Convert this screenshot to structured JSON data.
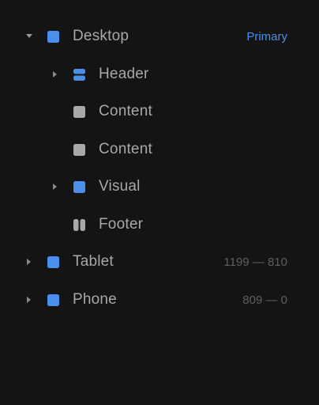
{
  "colors": {
    "background": "#141414",
    "accent": "#4a8fec",
    "text": "#a8a8a8",
    "muted": "#5f5f5f",
    "gray_icon": "#a8a8a8"
  },
  "layers": [
    {
      "label": "Desktop",
      "meta": "Primary",
      "icon": "blue-square-frame-icon",
      "caret": "caret-down-icon",
      "expanded": true
    },
    {
      "label": "Header",
      "meta": "",
      "icon": "stack-frame-icon",
      "caret": "caret-right-icon",
      "expanded": false
    },
    {
      "label": "Content",
      "meta": "",
      "icon": "gray-square-frame-icon",
      "caret": "",
      "expanded": false
    },
    {
      "label": "Content",
      "meta": "",
      "icon": "gray-square-frame-icon",
      "caret": "",
      "expanded": false
    },
    {
      "label": "Visual",
      "meta": "",
      "icon": "blue-square-frame-icon",
      "caret": "caret-right-icon",
      "expanded": false
    },
    {
      "label": "Footer",
      "meta": "",
      "icon": "columns-frame-icon",
      "caret": "",
      "expanded": false
    },
    {
      "label": "Tablet",
      "meta": "1199 — 810",
      "icon": "blue-square-frame-icon",
      "caret": "caret-right-icon",
      "expanded": false
    },
    {
      "label": "Phone",
      "meta": "809 — 0",
      "icon": "blue-square-frame-icon",
      "caret": "caret-right-icon",
      "expanded": false
    }
  ]
}
